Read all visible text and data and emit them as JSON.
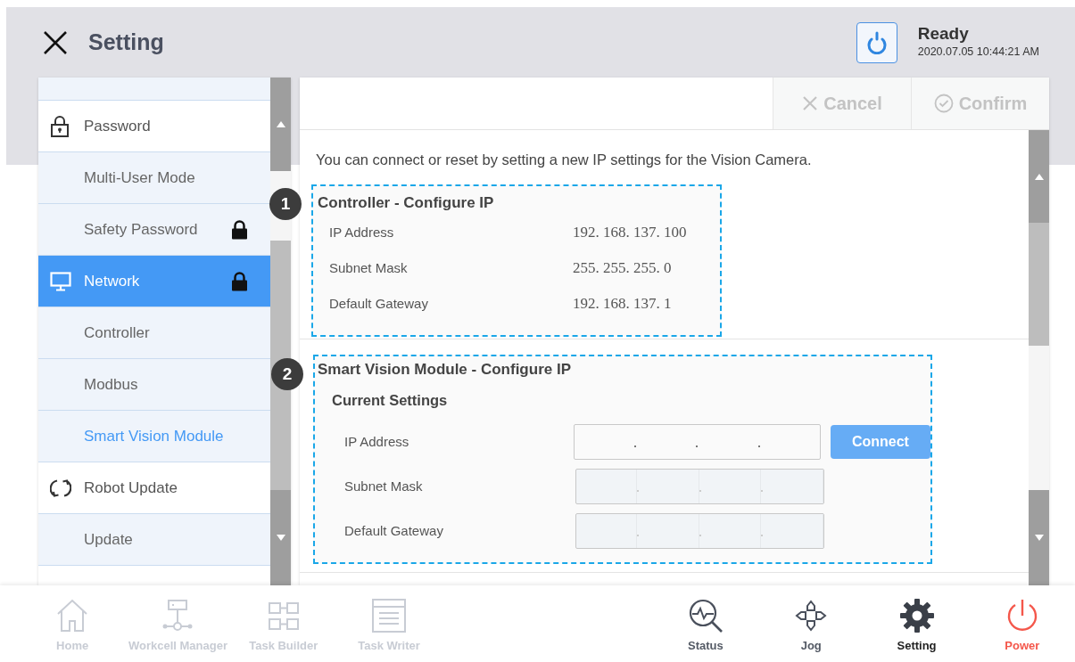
{
  "header": {
    "title": "Setting",
    "status": "Ready",
    "timestamp": "2020.07.05 10:44:21 AM"
  },
  "sidebar": {
    "items": [
      {
        "label": "Password",
        "kind": "password",
        "selected": false,
        "current": false,
        "locked": false
      },
      {
        "label": "Multi-User Mode",
        "kind": "sub",
        "selected": false,
        "current": false,
        "locked": false
      },
      {
        "label": "Safety Password",
        "kind": "sub",
        "selected": false,
        "current": false,
        "locked": true
      },
      {
        "label": "Network",
        "kind": "network",
        "selected": true,
        "current": false,
        "locked": true
      },
      {
        "label": "Controller",
        "kind": "sub",
        "selected": false,
        "current": false,
        "locked": false
      },
      {
        "label": "Modbus",
        "kind": "sub",
        "selected": false,
        "current": false,
        "locked": false
      },
      {
        "label": "Smart Vision Module",
        "kind": "sub",
        "selected": false,
        "current": true,
        "locked": false
      },
      {
        "label": "Robot Update",
        "kind": "update",
        "selected": false,
        "current": false,
        "locked": false
      },
      {
        "label": "Update",
        "kind": "sub",
        "selected": false,
        "current": false,
        "locked": false
      }
    ]
  },
  "toolbar": [
    {
      "label": "Cancel",
      "kind": "cancel",
      "disabled": true
    },
    {
      "label": "Confirm",
      "kind": "confirm",
      "disabled": true
    }
  ],
  "description": "You can connect or reset by setting a new IP settings for the Vision Camera.",
  "sections": [
    {
      "number": "1",
      "title": "Controller - Configure IP",
      "rows": [
        {
          "label": "IP Address",
          "value": "192. 168. 137. 100"
        },
        {
          "label": "Subnet Mask",
          "value": "255. 255. 255. 0"
        },
        {
          "label": "Default Gateway",
          "value": "192. 168. 137. 1"
        }
      ]
    },
    {
      "number": "2",
      "title": "Smart Vision Module - Configure IP",
      "subtitle": "Current Settings",
      "fields": [
        {
          "label": "IP Address",
          "disabled": false,
          "button": "Connect"
        },
        {
          "label": "Subnet Mask",
          "disabled": true
        },
        {
          "label": "Default Gateway",
          "disabled": true
        }
      ]
    }
  ],
  "nav": [
    {
      "label": "Home",
      "kind": "home",
      "disabled": true,
      "selected": false
    },
    {
      "label": "Workcell Manager",
      "kind": "workcell",
      "disabled": true,
      "selected": false
    },
    {
      "label": "Task Builder",
      "kind": "builder",
      "disabled": true,
      "selected": false
    },
    {
      "label": "Task Writer",
      "kind": "writer",
      "disabled": true,
      "selected": false
    },
    {
      "label": "Status",
      "kind": "status",
      "disabled": false,
      "selected": false
    },
    {
      "label": "Jog",
      "kind": "jog",
      "disabled": false,
      "selected": false
    },
    {
      "label": "Setting",
      "kind": "setting",
      "disabled": false,
      "selected": true
    },
    {
      "label": "Power",
      "kind": "power",
      "disabled": false,
      "selected": false
    }
  ]
}
